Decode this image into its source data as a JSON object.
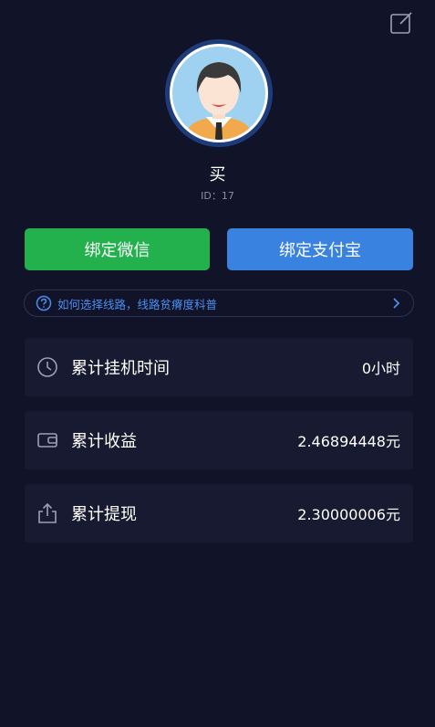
{
  "profile": {
    "name": "买",
    "id_text": "ID：17"
  },
  "actions": {
    "bind_wechat": "绑定微信",
    "bind_alipay": "绑定支付宝"
  },
  "route_tip": {
    "text": "如何选择线路，线路贫瘠度科普"
  },
  "stats": [
    {
      "label": "累计挂机时间",
      "value": "0小时",
      "icon": "clock-icon"
    },
    {
      "label": "累计收益",
      "value": "2.46894448元",
      "icon": "wallet-icon"
    },
    {
      "label": "累计提现",
      "value": "2.30000006元",
      "icon": "share-icon"
    }
  ],
  "colors": {
    "background": "#111329",
    "card": "#171a30",
    "wechat_green": "#22b14c",
    "alipay_blue": "#3a82e0",
    "link_blue": "#4c8ef0"
  }
}
